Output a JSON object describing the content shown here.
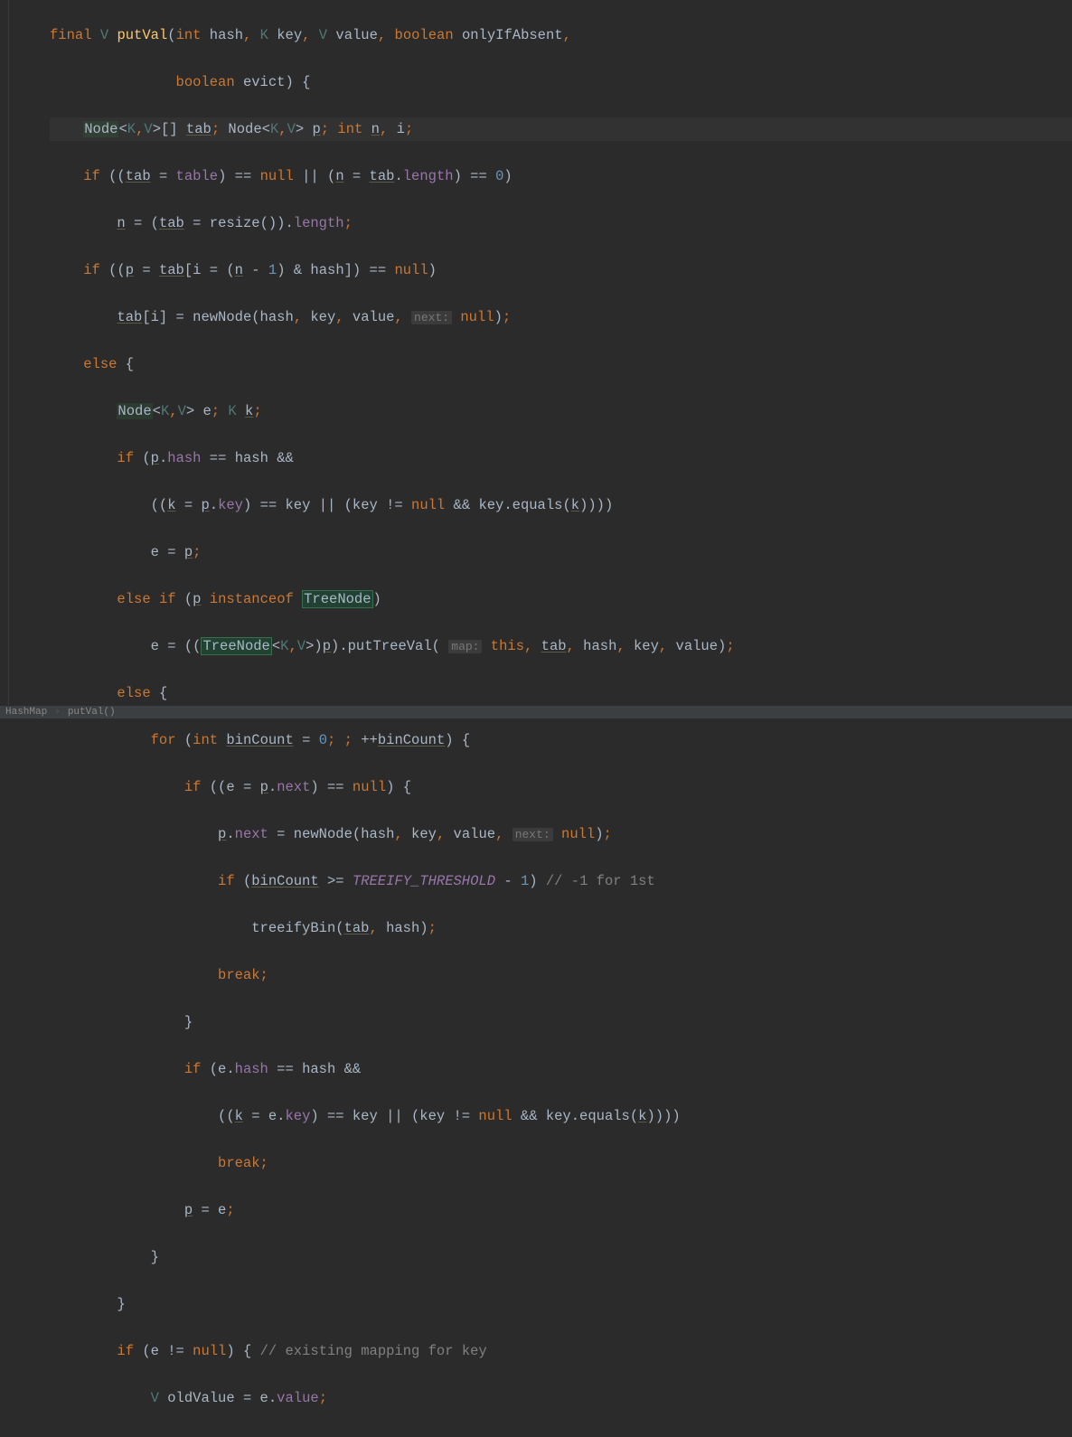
{
  "breadcrumb": {
    "class": "HashMap",
    "method": "putVal()"
  },
  "hints": {
    "next": "next:",
    "map": "map:"
  },
  "code": {
    "method_signature": {
      "final": "final",
      "V": "V",
      "name": "putVal",
      "params": "int hash, K key, V value, boolean onlyIfAbsent,",
      "params2": "boolean evict) {"
    },
    "lines": [
      "        Node<K,V>[] tab; Node<K,V> p; int n, i;",
      "        if ((tab = table) == null || (n = tab.length) == 0)",
      "            n = (tab = resize()).length;",
      "        if ((p = tab[i = (n - 1) & hash]) == null)",
      "            tab[i] = newNode(hash, key, value, next: null);",
      "        else {",
      "            Node<K,V> e; K k;",
      "            if (p.hash == hash &&",
      "                ((k = p.key) == key || (key != null && key.equals(k))))",
      "                e = p;",
      "            else if (p instanceof TreeNode)",
      "                e = ((TreeNode<K,V>)p).putTreeVal( map: this, tab, hash, key, value);",
      "            else {",
      "                for (int binCount = 0; ; ++binCount) {",
      "                    if ((e = p.next) == null) {",
      "                        p.next = newNode(hash, key, value, next: null);",
      "                        if (binCount >= TREEIFY_THRESHOLD - 1) // -1 for 1st",
      "                            treeifyBin(tab, hash);",
      "                        break;",
      "                    }",
      "                    if (e.hash == hash &&",
      "                        ((k = e.key) == key || (key != null && key.equals(k))))",
      "                        break;",
      "                    p = e;",
      "                }",
      "            }",
      "            if (e != null) { // existing mapping for key",
      "                V oldValue = e.value;"
    ],
    "tokens": {
      "final": "final",
      "int": "int",
      "boolean": "boolean",
      "if": "if",
      "else": "else",
      "null": "null",
      "for": "for",
      "break": "break",
      "instanceof": "instanceof",
      "this": "this",
      "K": "K",
      "V": "V",
      "Node": "Node",
      "TreeNode": "TreeNode",
      "tab": "tab",
      "table": "table",
      "n": "n",
      "i": "i",
      "p": "p",
      "e": "e",
      "k": "k",
      "hash": "hash",
      "key": "key",
      "value": "value",
      "length": "length",
      "next": "next",
      "resize": "resize",
      "newNode": "newNode",
      "putTreeVal": "putTreeVal",
      "treeifyBin": "treeifyBin",
      "equals": "equals",
      "binCount": "binCount",
      "TREEIFY_THRESHOLD": "TREEIFY_THRESHOLD",
      "oldValue": "oldValue",
      "zero": "0",
      "one": "1",
      "cmt1": "// -1 for 1st",
      "cmt2": "// existing mapping for key"
    }
  }
}
